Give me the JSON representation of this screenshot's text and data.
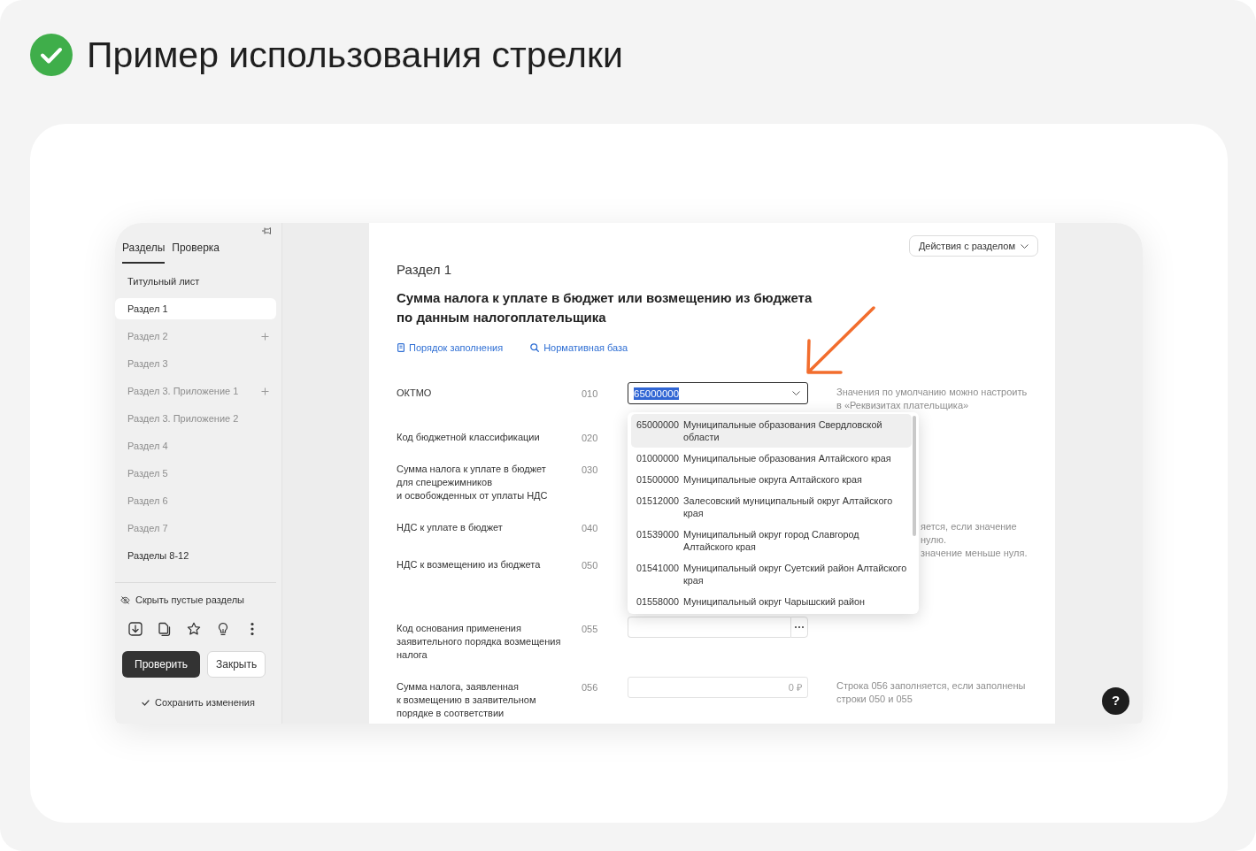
{
  "header": {
    "title": "Пример использования стрелки"
  },
  "sidebar": {
    "tabs": [
      {
        "label": "Разделы",
        "selected": true
      },
      {
        "label": "Проверка",
        "selected": false
      }
    ],
    "items": [
      {
        "label": "Титульный лист",
        "selected": false,
        "empty": false,
        "can_add": false
      },
      {
        "label": "Раздел 1",
        "selected": true,
        "empty": false,
        "can_add": false
      },
      {
        "label": "Раздел 2",
        "selected": false,
        "empty": true,
        "can_add": true
      },
      {
        "label": "Раздел 3",
        "selected": false,
        "empty": true,
        "can_add": false
      },
      {
        "label": "Раздел 3. Приложение 1",
        "selected": false,
        "empty": true,
        "can_add": true
      },
      {
        "label": "Раздел 3. Приложение 2",
        "selected": false,
        "empty": true,
        "can_add": false
      },
      {
        "label": "Раздел 4",
        "selected": false,
        "empty": true,
        "can_add": false
      },
      {
        "label": "Раздел 5",
        "selected": false,
        "empty": true,
        "can_add": false
      },
      {
        "label": "Раздел 6",
        "selected": false,
        "empty": true,
        "can_add": false
      },
      {
        "label": "Раздел 7",
        "selected": false,
        "empty": true,
        "can_add": false
      },
      {
        "label": "Разделы 8-12",
        "selected": false,
        "empty": false,
        "can_add": false
      }
    ],
    "hide_empty": {
      "label": "Скрыть пустые разделы"
    },
    "buttons": [
      {
        "label": "Проверить",
        "kind": "primary"
      },
      {
        "label": "Закрыть",
        "kind": "secondary"
      }
    ],
    "save": {
      "label": "Сохранить изменения"
    }
  },
  "main": {
    "actions_button": {
      "label": "Действия с разделом"
    },
    "section": "Раздел 1",
    "title": "Сумма налога к уплате в бюджет или возмещению из бюджета по данным налогоплательщика",
    "links": [
      {
        "label": "Порядок заполнения",
        "kind": "guide"
      },
      {
        "label": "Нормативная база",
        "kind": "search"
      }
    ],
    "rows": [
      {
        "label": [
          "ОКТМО"
        ],
        "code": "010",
        "field": {
          "kind": "select",
          "value": "65000000",
          "value_highlighted": true,
          "open": true,
          "options": [
            {
              "code": "65000000",
              "name": [
                "Муниципальные образования Свердловской",
                "области"
              ],
              "selected": true
            },
            {
              "code": "01000000",
              "name": [
                "Муниципальные образования Алтайского края"
              ],
              "selected": false
            },
            {
              "code": "01500000",
              "name": [
                "Муниципальные округа Алтайского края"
              ],
              "selected": false
            },
            {
              "code": "01512000",
              "name": [
                "Залесовский муниципальный округ Алтайского",
                "края"
              ],
              "selected": false
            },
            {
              "code": "01539000",
              "name": [
                "Муниципальный округ город Славгород",
                "Алтайского края"
              ],
              "selected": false
            },
            {
              "code": "01541000",
              "name": [
                "Муниципальный округ Суетский район Алтайского",
                "края"
              ],
              "selected": false
            },
            {
              "code": "01558000",
              "name": [
                "Муниципальный округ Чарышский район"
              ],
              "selected": false
            }
          ]
        },
        "hint": [
          "Значения по умолчанию можно настроить",
          "в «Реквизитах плательщика»"
        ],
        "hint_behind_dropdown": false
      },
      {
        "label": [
          "Код бюджетной классификации"
        ],
        "code": "020"
      },
      {
        "label": [
          "Сумма налога к уплате в бюджет",
          "для спецрежимников",
          "и освобожденных от уплаты НДС"
        ],
        "code": "030"
      },
      {
        "label": [
          "НДС к уплате в бюджет"
        ],
        "code": "040",
        "hint": [
          "яется, если значение",
          "нулю.",
          "значение меньше нуля."
        ],
        "hint_behind_dropdown": true
      },
      {
        "label": [
          "НДС к возмещению из бюджета"
        ],
        "code": "050"
      },
      {
        "label": [
          "Код основания применения",
          "заявительного порядка возмещения",
          "налога"
        ],
        "code": "055",
        "field": {
          "kind": "lookup"
        }
      },
      {
        "label": [
          "Сумма налога, заявленная",
          "к возмещению в заявительном",
          "порядке в соответствии"
        ],
        "code": "056",
        "field": {
          "kind": "money",
          "placeholder": "0 ₽"
        },
        "hint": [
          "Строка 056 заполняется, если заполнены",
          "строки 050 и 055"
        ],
        "hint_behind_dropdown": false
      }
    ]
  },
  "help_button": {
    "label": "?"
  }
}
